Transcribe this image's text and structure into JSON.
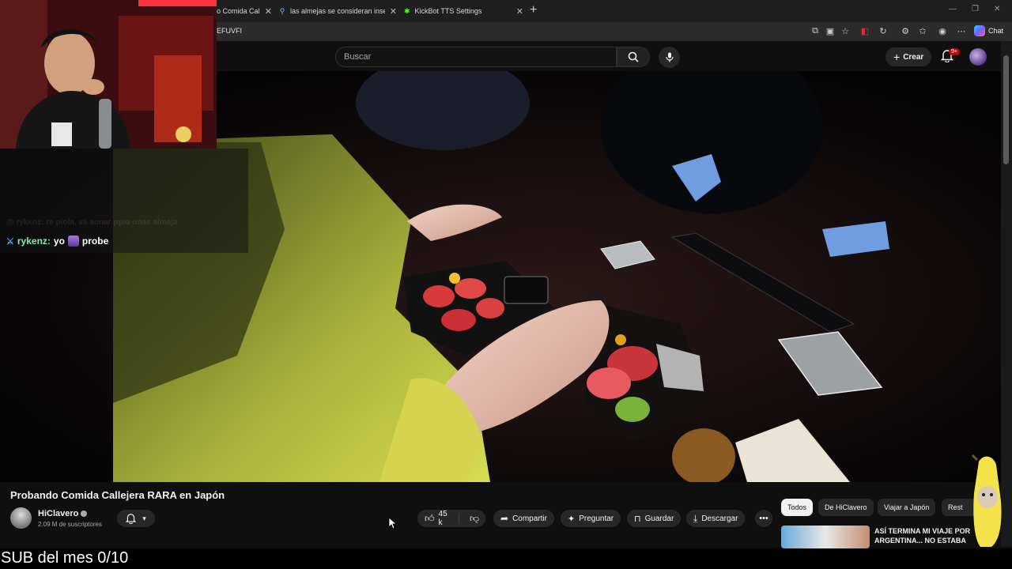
{
  "browser": {
    "tabs": [
      {
        "label": "o Comida Calle",
        "favicon": "youtube-icon"
      },
      {
        "label": "las almejas se consideran insectos",
        "favicon": "search-icon"
      },
      {
        "label": "KickBot TTS Settings",
        "favicon": "kickbot-icon"
      }
    ],
    "url_fragment": "EFUVFI",
    "chat_label": "Chat"
  },
  "youtube": {
    "search_placeholder": "Buscar",
    "create_label": "Crear",
    "notif_badge": "9+"
  },
  "overlay": {
    "chat_faded": "@ rykenz: re piola, vá sonar ppio unas almeja",
    "chat_user": "rykenz:",
    "chat_message_a": "yo",
    "chat_message_b": "probe",
    "sub_goal": "SUB del mes 0/10"
  },
  "video": {
    "title": "Probando Comida Callejera RARA en Japón",
    "channel_name": "HiClavero",
    "subscribers": "2.09 M de suscriptores",
    "likes": "45 k",
    "actions": {
      "share": "Compartir",
      "ask": "Preguntar",
      "save": "Guardar",
      "download": "Descargar"
    }
  },
  "sidebar": {
    "chips": [
      "Todos",
      "De HiClavero",
      "Viajar a Japón",
      "Rest"
    ],
    "recommended_title": "ASÍ TERMINA MI VIAJE POR ARGENTINA... NO ESTABA"
  },
  "colors": {
    "bg": "#0f0f0f",
    "pill": "#272727",
    "chat_user": "#7ef0a8",
    "badge": "#cc0000"
  }
}
